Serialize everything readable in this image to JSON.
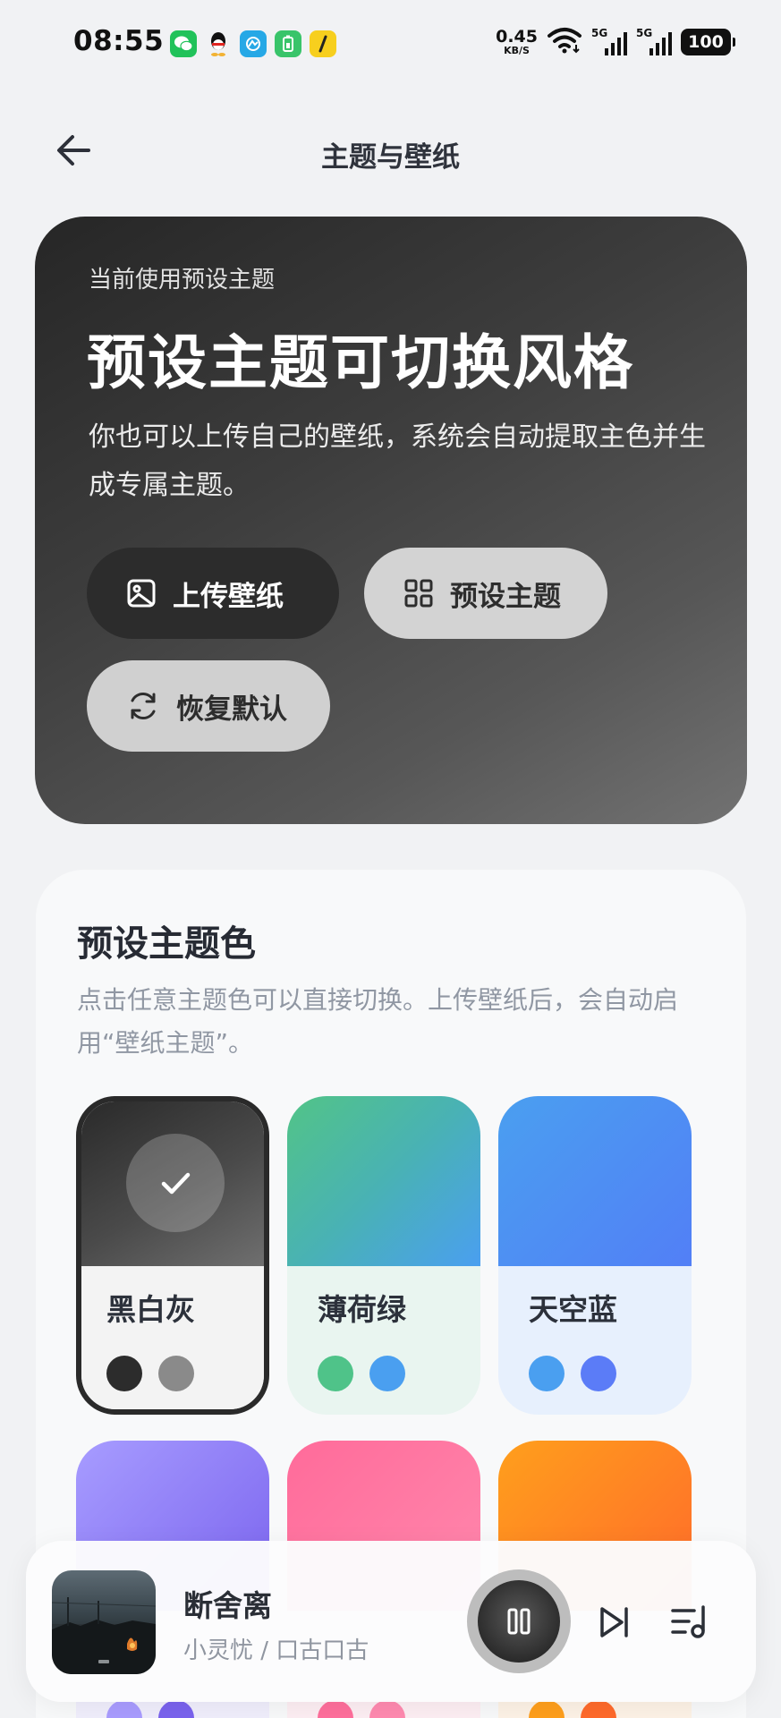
{
  "status_bar": {
    "time": "08:55",
    "net_speed_value": "0.45",
    "net_speed_unit": "KB/S",
    "signal_1_label": "5G",
    "signal_2_label": "5G",
    "battery": "100",
    "notification_icons": [
      "wechat-icon",
      "qq-icon",
      "blue-app-icon",
      "green-app-icon",
      "yellow-app-icon"
    ]
  },
  "header": {
    "title": "主题与壁纸"
  },
  "hero": {
    "eyebrow": "当前使用预设主题",
    "title": "预设主题可切换风格",
    "description": "你也可以上传自己的壁纸，系统会自动提取主色并生成专属主题。",
    "upload_label": "上传壁纸",
    "preset_label": "预设主题",
    "reset_label": "恢复默认"
  },
  "theme_panel": {
    "title": "预设主题色",
    "description": "点击任意主题色可以直接切换。上传壁纸后，会自动启用“壁纸主题”。",
    "themes": [
      {
        "name": "黑白灰",
        "selected": true,
        "colors": [
          "#2c2c2c",
          "#8a8a8a"
        ]
      },
      {
        "name": "薄荷绿",
        "selected": false,
        "colors": [
          "#4fc389",
          "#4a9ff0"
        ]
      },
      {
        "name": "天空蓝",
        "selected": false,
        "colors": [
          "#4a9ff0",
          "#5b7cf7"
        ]
      },
      {
        "name": "",
        "selected": false,
        "colors": [
          "#a99cff",
          "#7a63ee"
        ]
      },
      {
        "name": "",
        "selected": false,
        "colors": [
          "#ff6f9c",
          "#ff8ab0"
        ]
      },
      {
        "name": "",
        "selected": false,
        "colors": [
          "#ff9f1c",
          "#ff6a2b"
        ]
      }
    ]
  },
  "player": {
    "song_title": "断舍离",
    "artist": "小灵忧 / 口古口古",
    "state": "playing"
  },
  "colors": {
    "page_bg": "#f1f2f4",
    "hero_dark": "#262626",
    "accent_dark": "#2c2c2c"
  }
}
